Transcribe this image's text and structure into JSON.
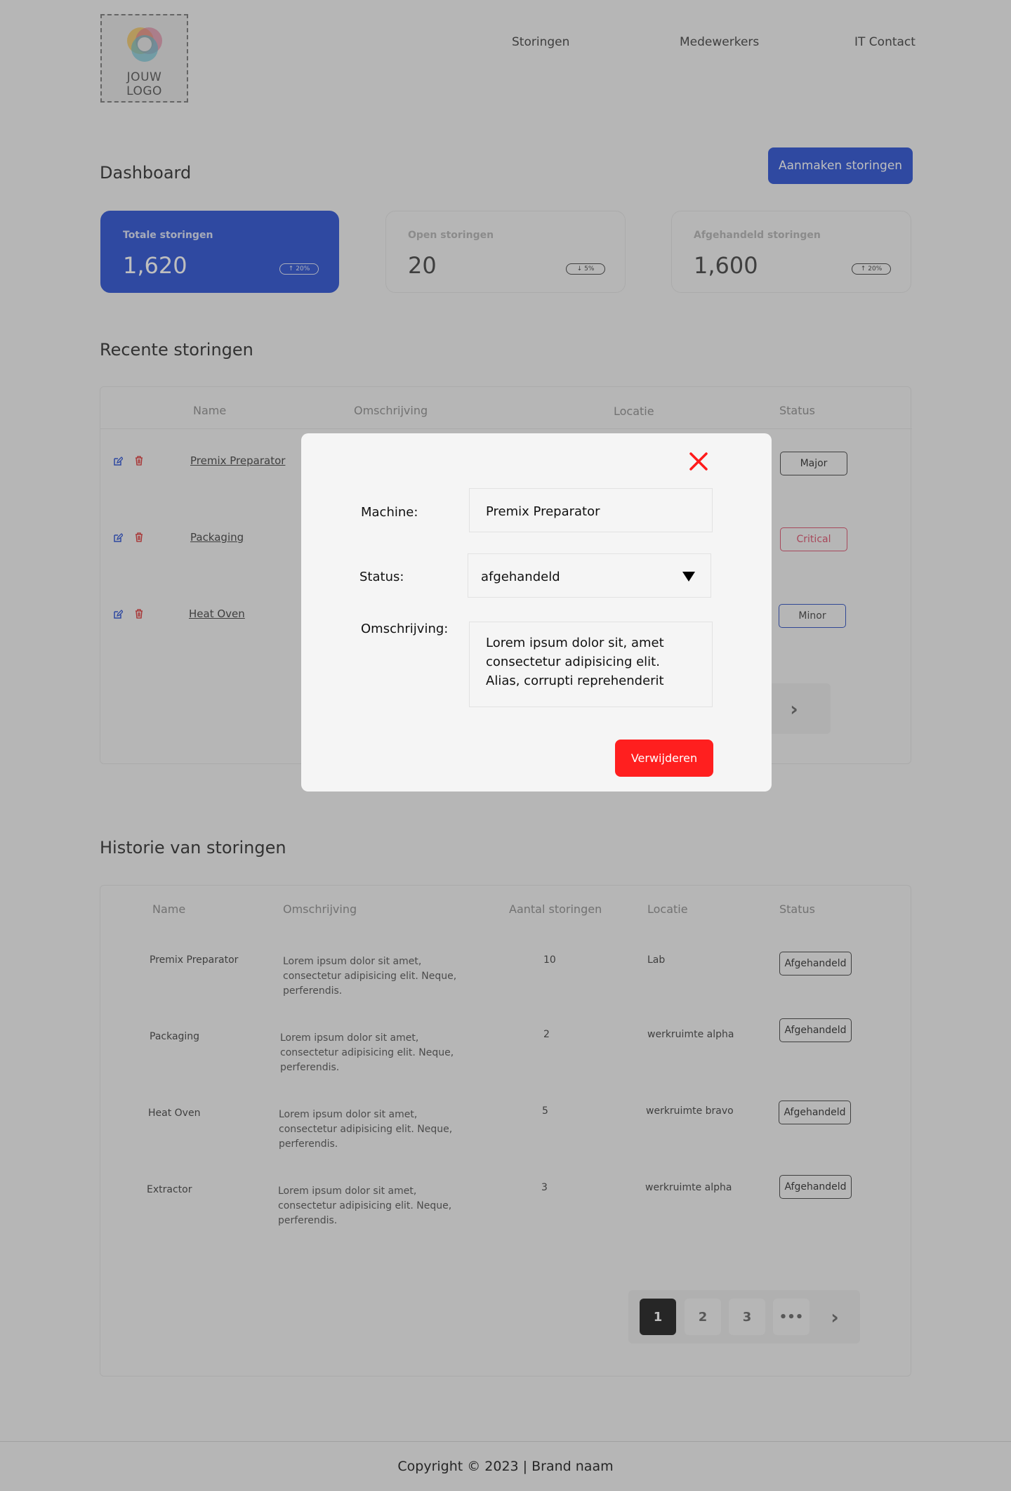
{
  "logo": {
    "line1": "JOUW",
    "line2": "LOGO"
  },
  "nav": {
    "items": [
      "Storingen",
      "Medewerkers",
      "IT Contact"
    ]
  },
  "dashboard": {
    "title": "Dashboard",
    "create_button": "Aanmaken storingen",
    "stats": [
      {
        "label": "Totale storingen",
        "value": "1,620",
        "trend": "20%",
        "direction": "up"
      },
      {
        "label": "Open storingen",
        "value": "20",
        "trend": "5%",
        "direction": "down"
      },
      {
        "label": "Afgehandeld storingen",
        "value": "1,600",
        "trend": "20%",
        "direction": "up"
      }
    ]
  },
  "recent": {
    "title": "Recente storingen",
    "headers": [
      "Name",
      "Omschrijving",
      "Locatie",
      "Status"
    ],
    "rows": [
      {
        "name": "Premix Preparator",
        "status": "Major"
      },
      {
        "name": "Packaging",
        "status": "Critical"
      },
      {
        "name": "Heat Oven",
        "status": "Minor"
      }
    ],
    "pager": {
      "more": "•••",
      "next": "›"
    }
  },
  "history": {
    "title": "Historie van storingen",
    "headers": [
      "Name",
      "Omschrijving",
      "Aantal storingen",
      "Locatie",
      "Status"
    ],
    "rows": [
      {
        "name": "Premix Preparator",
        "description": "Lorem ipsum dolor sit amet, consectetur adipisicing elit. Neque, perferendis.",
        "count": "10",
        "location": "Lab",
        "status": "Afgehandeld"
      },
      {
        "name": "Packaging",
        "description": "Lorem ipsum dolor sit amet, consectetur adipisicing elit. Neque, perferendis.",
        "count": "2",
        "location": "werkruimte alpha",
        "status": "Afgehandeld"
      },
      {
        "name": "Heat Oven",
        "description": "Lorem ipsum dolor sit amet, consectetur adipisicing elit. Neque, perferendis.",
        "count": "5",
        "location": "werkruimte bravo",
        "status": "Afgehandeld"
      },
      {
        "name": "Extractor",
        "description": "Lorem ipsum dolor sit amet, consectetur adipisicing elit. Neque, perferendis.",
        "count": "3",
        "location": "werkruimte alpha",
        "status": "Afgehandeld"
      }
    ],
    "pager": {
      "pages": [
        "1",
        "2",
        "3"
      ],
      "more": "•••",
      "next": "›",
      "current": "1"
    }
  },
  "footer": {
    "text": "Copyright © 2023 | Brand naam"
  },
  "modal": {
    "machine_label": "Machine:",
    "machine_value": "Premix Preparator",
    "status_label": "Status:",
    "status_value": "afgehandeld",
    "description_label": "Omschrijving:",
    "description_value": "Lorem ipsum dolor sit, amet consectetur adipisicing elit. Alias, corrupti reprehenderit",
    "delete_button": "Verwijderen",
    "close_icon": "close-icon"
  },
  "colors": {
    "primary": "#3f63d8",
    "danger": "#ff1f1f",
    "critical": "#e0617a"
  }
}
